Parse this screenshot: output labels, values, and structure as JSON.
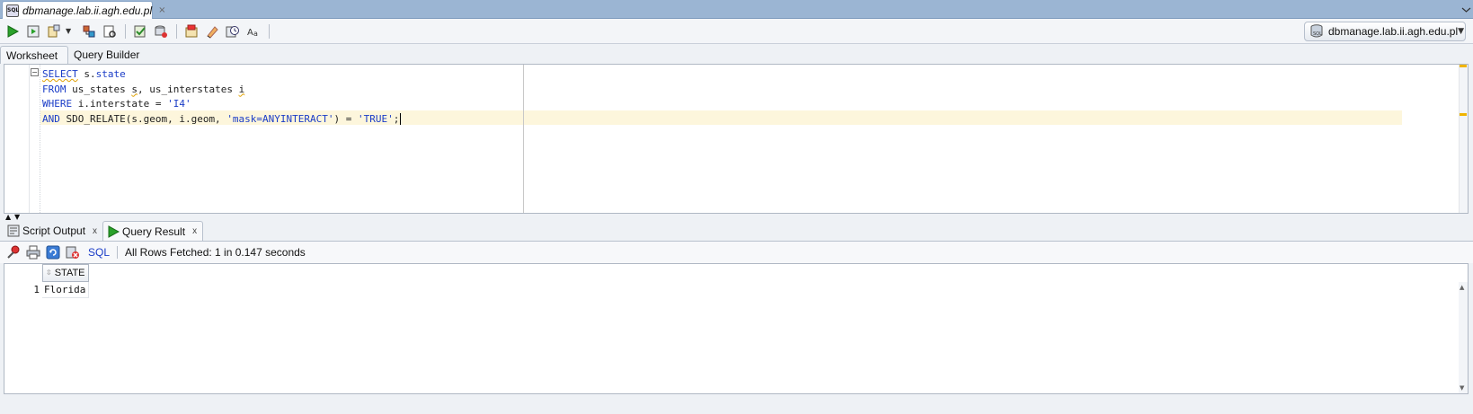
{
  "document_tab": {
    "title": "dbmanage.lab.ii.agh.edu.pl",
    "close": "×",
    "icon_text": "SQL"
  },
  "toolbar": {
    "buttons": [
      "run-statement-icon",
      "run-script-icon",
      "autotrace-icon",
      "explain-plan-icon",
      "sql-tuning-icon",
      "commit-icon",
      "rollback-icon",
      "unshared-worksheet-icon",
      "clear-icon",
      "history-icon",
      "format-icon"
    ],
    "dropdown": "▼",
    "connection": {
      "label": "dbmanage.lab.ii.agh.edu.pl",
      "chevron": "▼"
    }
  },
  "worksheet_tabs": [
    {
      "label": "Worksheet",
      "active": true
    },
    {
      "label": "Query Builder",
      "active": false
    }
  ],
  "editor": {
    "fold": "−",
    "lines": [
      [
        {
          "t": "SELECT",
          "c": "kw squig"
        },
        {
          "t": " s.",
          "c": "id"
        },
        {
          "t": "state",
          "c": "kw"
        }
      ],
      [
        {
          "t": "FROM",
          "c": "kw"
        },
        {
          "t": " us_states ",
          "c": "id"
        },
        {
          "t": "s",
          "c": "id squig"
        },
        {
          "t": ", us_interstates ",
          "c": "id"
        },
        {
          "t": "i",
          "c": "id squig"
        }
      ],
      [
        {
          "t": "WHERE",
          "c": "kw"
        },
        {
          "t": " i.interstate = ",
          "c": "id"
        },
        {
          "t": "'I4'",
          "c": "str"
        }
      ],
      [
        {
          "t": "AND",
          "c": "kw"
        },
        {
          "t": " SDO_RELATE(s.geom, i.geom, ",
          "c": "id"
        },
        {
          "t": "'mask=ANYINTERACT'",
          "c": "str"
        },
        {
          "t": ") = ",
          "c": "id"
        },
        {
          "t": "'TRUE'",
          "c": "str"
        },
        {
          "t": ";",
          "c": "id"
        }
      ]
    ]
  },
  "splitter": {
    "up": "▲",
    "down": "▼"
  },
  "output_tabs": [
    {
      "label": "Script Output",
      "close": "x",
      "active": false
    },
    {
      "label": "Query Result",
      "close": "x",
      "active": true
    }
  ],
  "result_toolbar": {
    "sql_label": "SQL",
    "status": "All Rows Fetched: 1 in 0.147 seconds"
  },
  "grid": {
    "columns": [
      "STATE"
    ],
    "sort_icon": "⇳",
    "rows": [
      {
        "num": "1",
        "cells": [
          "Florida"
        ]
      }
    ],
    "scroll_up": "▲",
    "scroll_down": "▼"
  },
  "colors": {
    "keyword": "#1a3cc7",
    "current_line": "#fdf6dc",
    "warning_mark": "#f0b400",
    "tab_strip": "#9bb5d3"
  }
}
